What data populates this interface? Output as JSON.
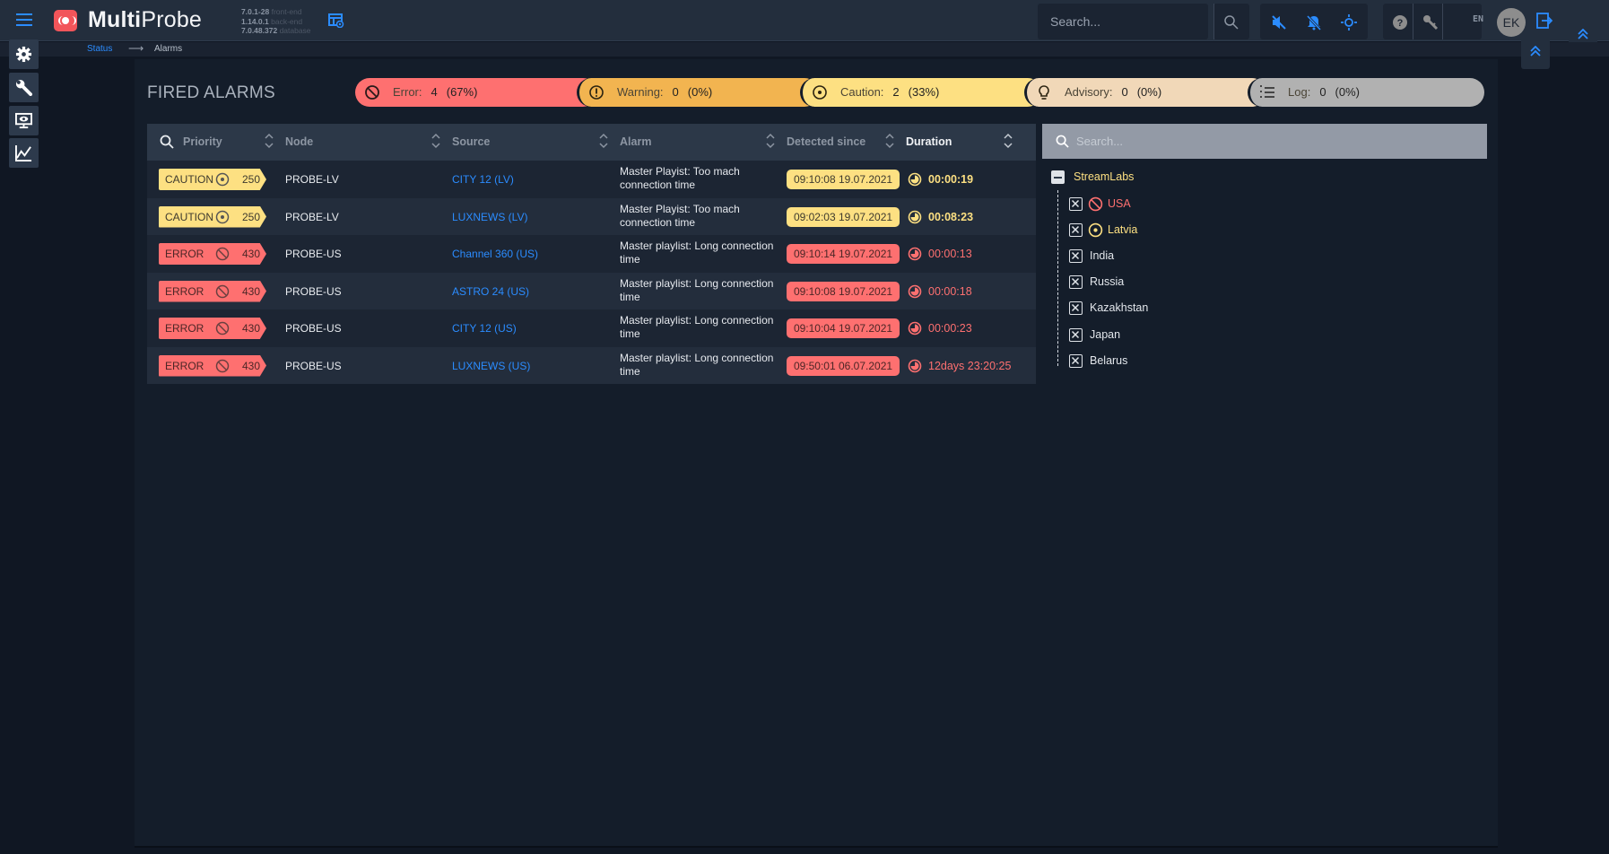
{
  "header": {
    "app_name_bold": "Multi",
    "app_name_regular": "Probe",
    "versions": [
      {
        "value": "7.0.1-28",
        "label": "front-end"
      },
      {
        "value": "1.14.0.1",
        "label": "back-end"
      },
      {
        "value": "7.0.48.372",
        "label": "database"
      }
    ],
    "search_placeholder": "Search...",
    "language": "EN",
    "user_initials": "EK"
  },
  "breadcrumb": {
    "items": [
      "Status",
      "Alarms"
    ],
    "separator": "⟶"
  },
  "page": {
    "title": "FIRED ALARMS"
  },
  "summary": [
    {
      "level": "error",
      "label": "Error:",
      "count": "4",
      "percent": "(67%)",
      "color": "#fe7070"
    },
    {
      "level": "warning",
      "label": "Warning:",
      "count": "0",
      "percent": "(0%)",
      "color": "#f2b450"
    },
    {
      "level": "caution",
      "label": "Caution:",
      "count": "2",
      "percent": "(33%)",
      "color": "#fde082"
    },
    {
      "level": "advisory",
      "label": "Advisory:",
      "count": "0",
      "percent": "(0%)",
      "color": "#f1d8b8"
    },
    {
      "level": "log",
      "label": "Log:",
      "count": "0",
      "percent": "(0%)",
      "color": "#b1b1b1"
    }
  ],
  "table": {
    "columns": [
      "Priority",
      "Node",
      "Source",
      "Alarm",
      "Detected since",
      "Duration"
    ],
    "rows": [
      {
        "level": "CAUTION",
        "priority": "250",
        "node": "PROBE-LV",
        "source": "CITY 12 (LV)",
        "alarm": "Master Playist: Too mach connection time",
        "detected": "09:10:08  19.07.2021",
        "duration": "00:00:19"
      },
      {
        "level": "CAUTION",
        "priority": "250",
        "node": "PROBE-LV",
        "source": "LUXNEWS (LV)",
        "alarm": "Master Playist: Too mach connection time",
        "detected": "09:02:03  19.07.2021",
        "duration": "00:08:23"
      },
      {
        "level": "ERROR",
        "priority": "430",
        "node": "PROBE-US",
        "source": "Channel 360 (US)",
        "alarm": "Master playlist: Long connection time",
        "detected": "09:10:14  19.07.2021",
        "duration": "00:00:13"
      },
      {
        "level": "ERROR",
        "priority": "430",
        "node": "PROBE-US",
        "source": "ASTRO 24 (US)",
        "alarm": "Master playlist: Long connection time",
        "detected": "09:10:08  19.07.2021",
        "duration": "00:00:18"
      },
      {
        "level": "ERROR",
        "priority": "430",
        "node": "PROBE-US",
        "source": "CITY 12 (US)",
        "alarm": "Master playlist: Long connection time",
        "detected": "09:10:04  19.07.2021",
        "duration": "00:00:23"
      },
      {
        "level": "ERROR",
        "priority": "430",
        "node": "PROBE-US",
        "source": "LUXNEWS (US)",
        "alarm": "Master playlist: Long connection time",
        "detected": "09:50:01  06.07.2021",
        "duration": "12days  23:20:25"
      }
    ]
  },
  "tree": {
    "search_placeholder": "Search...",
    "root": "StreamLabs",
    "items": [
      {
        "label": "USA",
        "status": "error"
      },
      {
        "label": "Latvia",
        "status": "caution"
      },
      {
        "label": "India",
        "status": "none"
      },
      {
        "label": "Russia",
        "status": "none"
      },
      {
        "label": "Kazakhstan",
        "status": "none"
      },
      {
        "label": "Japan",
        "status": "none"
      },
      {
        "label": "Belarus",
        "status": "none"
      }
    ]
  },
  "colors": {
    "accent": "#2b8cff",
    "error": "#fe7070",
    "warning": "#f2b450",
    "caution": "#fde082",
    "advisory": "#f1d8b8",
    "log": "#b1b1b1"
  }
}
